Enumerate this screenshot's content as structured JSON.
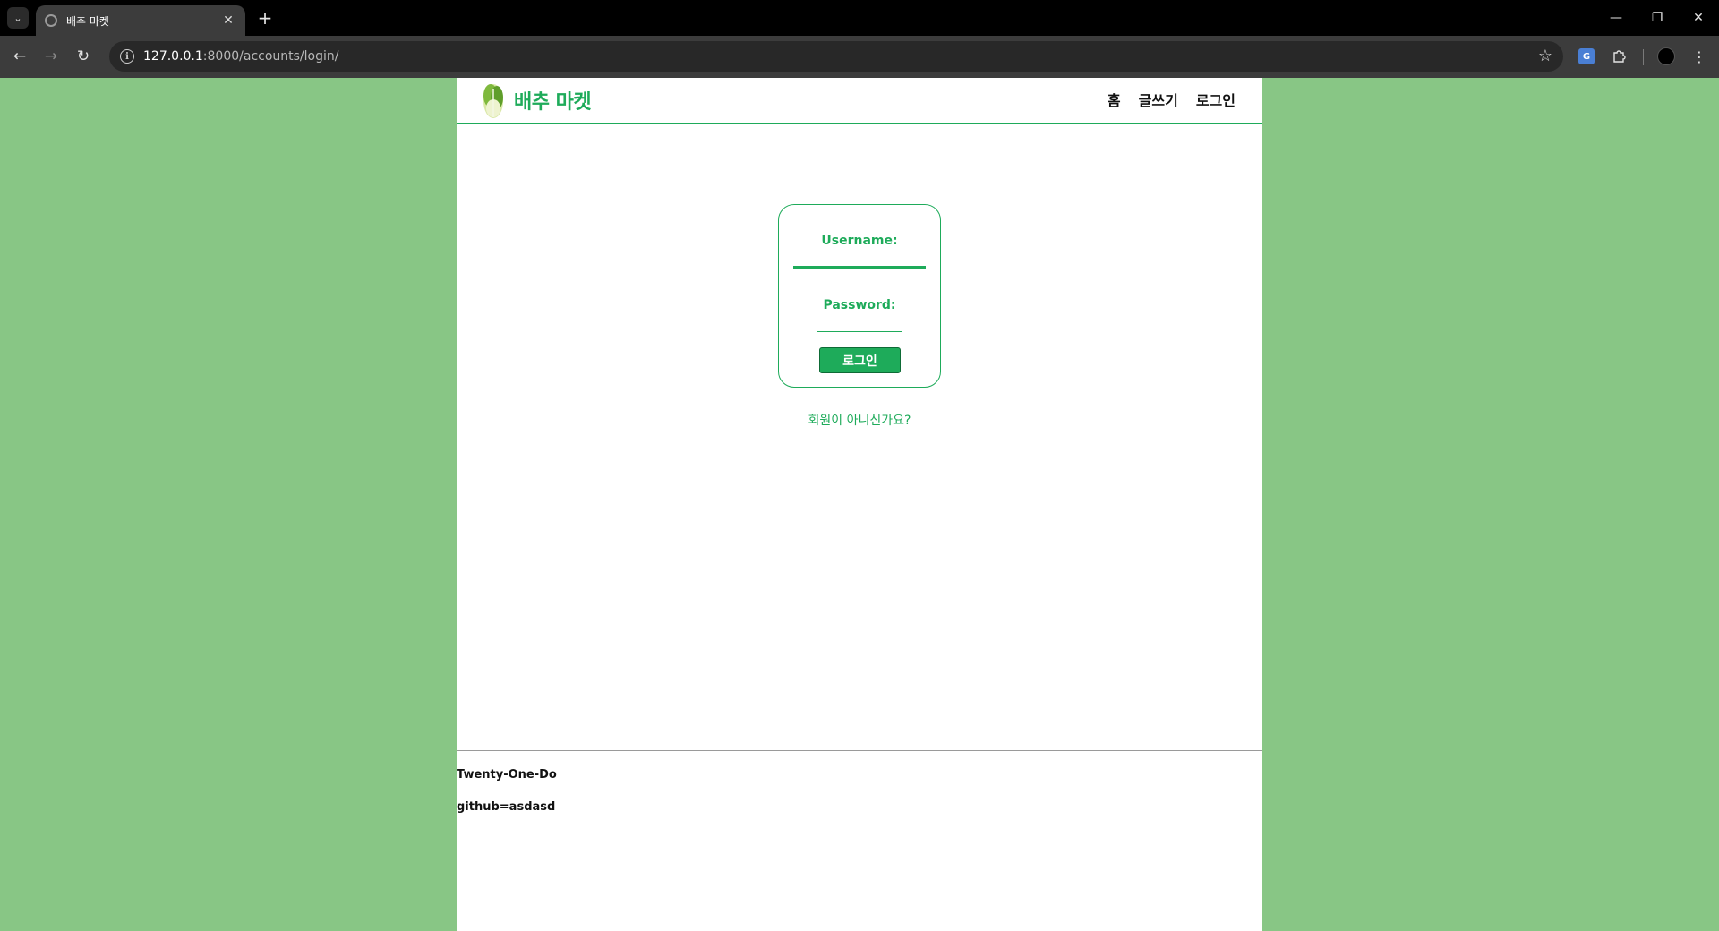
{
  "browser": {
    "tab_title": "배추 마켓",
    "tab_close": "✕",
    "new_tab": "+",
    "url_host": "127.0.0.1",
    "url_path": ":8000/accounts/login/",
    "window_controls": {
      "minimize": "—",
      "restore": "❐",
      "close": "✕"
    }
  },
  "header": {
    "brand_name": "배추 마켓",
    "nav": [
      {
        "label": "홈"
      },
      {
        "label": "글쓰기"
      },
      {
        "label": "로그인"
      }
    ]
  },
  "login_form": {
    "username_label": "Username:",
    "username_value": "",
    "password_label": "Password:",
    "password_value": "",
    "submit_label": "로그인"
  },
  "signup_link": "회원이 아니신가요?",
  "footer": {
    "line1": "Twenty-One-Do",
    "line2": "github=asdasd"
  },
  "colors": {
    "accent": "#1eab5a",
    "page_background": "#88c685"
  }
}
